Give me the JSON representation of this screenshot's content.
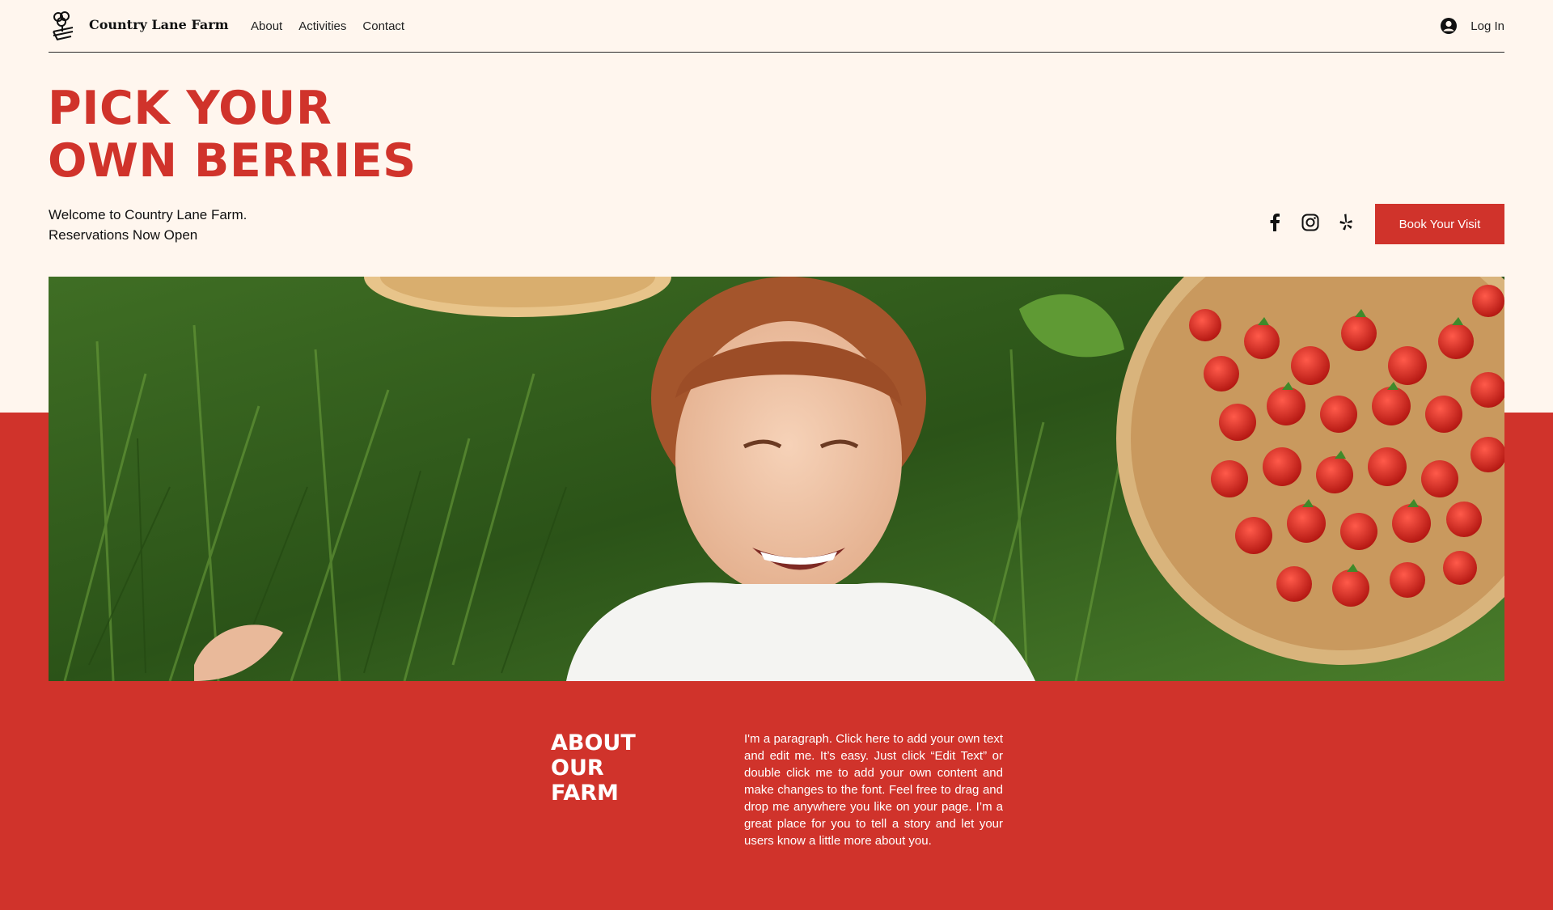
{
  "header": {
    "brand": "Country Lane Farm",
    "nav": [
      "About",
      "Activities",
      "Contact"
    ],
    "login_label": "Log In"
  },
  "hero": {
    "title": "PICK YOUR\nOWN BERRIES",
    "tagline": "Welcome to Country Lane Farm.\nReservations Now Open",
    "book_button": "Book Your Visit",
    "socials": [
      "facebook-icon",
      "instagram-icon",
      "yelp-icon"
    ]
  },
  "about": {
    "heading": "ABOUT\nOUR\nFARM",
    "paragraph": "I'm a paragraph. Click here to add your own text and edit me. It’s easy. Just click “Edit Text” or double click me to add your own content and make changes to the font. Feel free to drag and drop me anywhere you like on your page. I’m a great place for you to tell a story and let your users know a little more about you."
  },
  "colors": {
    "accent": "#d0332b",
    "background": "#fff6ee"
  }
}
